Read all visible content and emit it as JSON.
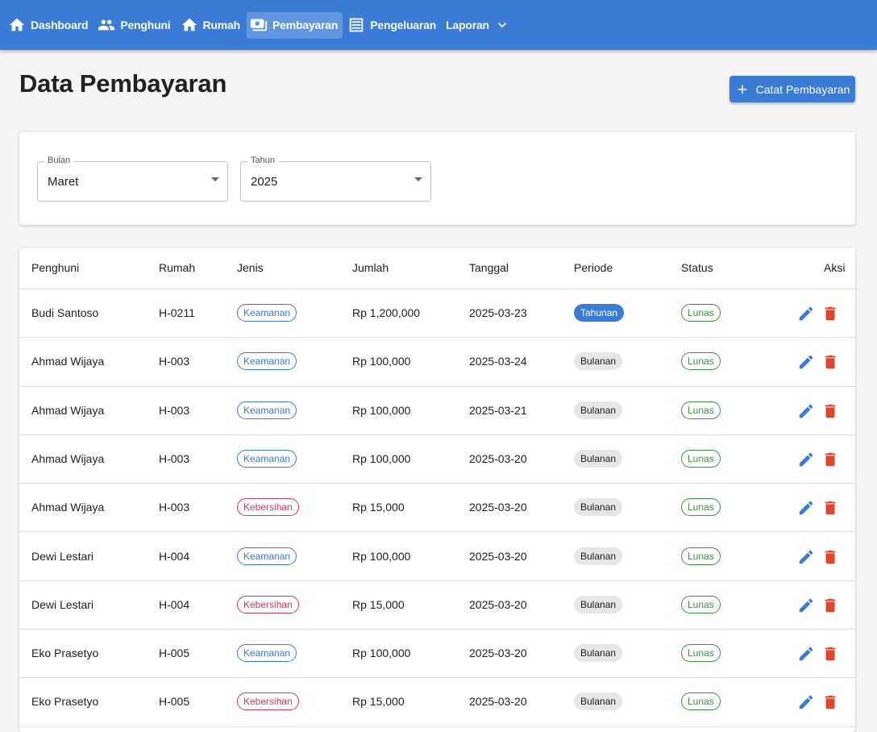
{
  "nav": {
    "items": [
      {
        "label": "Dashboard",
        "icon": "home-icon",
        "active": false
      },
      {
        "label": "Penghuni",
        "icon": "people-icon",
        "active": false
      },
      {
        "label": "Rumah",
        "icon": "house-icon",
        "active": false
      },
      {
        "label": "Pembayaran",
        "icon": "payments-icon",
        "active": true
      },
      {
        "label": "Pengeluaran",
        "icon": "receipt-icon",
        "active": false
      },
      {
        "label": "Laporan",
        "icon": "chevron-down-icon",
        "active": false
      }
    ]
  },
  "page": {
    "title": "Data Pembayaran",
    "add_button_label": "Catat Pembayaran"
  },
  "filters": {
    "month": {
      "label": "Bulan",
      "value": "Maret"
    },
    "year": {
      "label": "Tahun",
      "value": "2025"
    }
  },
  "table": {
    "headers": [
      "Penghuni",
      "Rumah",
      "Jenis",
      "Jumlah",
      "Tanggal",
      "Periode",
      "Status",
      "Aksi"
    ],
    "rows": [
      {
        "penghuni": "Budi Santoso",
        "rumah": "H-0211",
        "jenis": "Keamanan",
        "jumlah": "Rp 1,200,000",
        "tanggal": "2025-03-23",
        "periode": "Tahunan",
        "status": "Lunas"
      },
      {
        "penghuni": "Ahmad Wijaya",
        "rumah": "H-003",
        "jenis": "Keamanan",
        "jumlah": "Rp 100,000",
        "tanggal": "2025-03-24",
        "periode": "Bulanan",
        "status": "Lunas"
      },
      {
        "penghuni": "Ahmad Wijaya",
        "rumah": "H-003",
        "jenis": "Keamanan",
        "jumlah": "Rp 100,000",
        "tanggal": "2025-03-21",
        "periode": "Bulanan",
        "status": "Lunas"
      },
      {
        "penghuni": "Ahmad Wijaya",
        "rumah": "H-003",
        "jenis": "Keamanan",
        "jumlah": "Rp 100,000",
        "tanggal": "2025-03-20",
        "periode": "Bulanan",
        "status": "Lunas"
      },
      {
        "penghuni": "Ahmad Wijaya",
        "rumah": "H-003",
        "jenis": "Kebersihan",
        "jumlah": "Rp 15,000",
        "tanggal": "2025-03-20",
        "periode": "Bulanan",
        "status": "Lunas"
      },
      {
        "penghuni": "Dewi Lestari",
        "rumah": "H-004",
        "jenis": "Keamanan",
        "jumlah": "Rp 100,000",
        "tanggal": "2025-03-20",
        "periode": "Bulanan",
        "status": "Lunas"
      },
      {
        "penghuni": "Dewi Lestari",
        "rumah": "H-004",
        "jenis": "Kebersihan",
        "jumlah": "Rp 15,000",
        "tanggal": "2025-03-20",
        "periode": "Bulanan",
        "status": "Lunas"
      },
      {
        "penghuni": "Eko Prasetyo",
        "rumah": "H-005",
        "jenis": "Keamanan",
        "jumlah": "Rp 100,000",
        "tanggal": "2025-03-20",
        "periode": "Bulanan",
        "status": "Lunas"
      },
      {
        "penghuni": "Eko Prasetyo",
        "rumah": "H-005",
        "jenis": "Kebersihan",
        "jumlah": "Rp 15,000",
        "tanggal": "2025-03-20",
        "periode": "Bulanan",
        "status": "Lunas"
      }
    ]
  },
  "colors": {
    "primary": "#3a7bd5",
    "danger": "#e0452e",
    "kebersihan": "#d23a5a",
    "success": "#3f9142"
  }
}
